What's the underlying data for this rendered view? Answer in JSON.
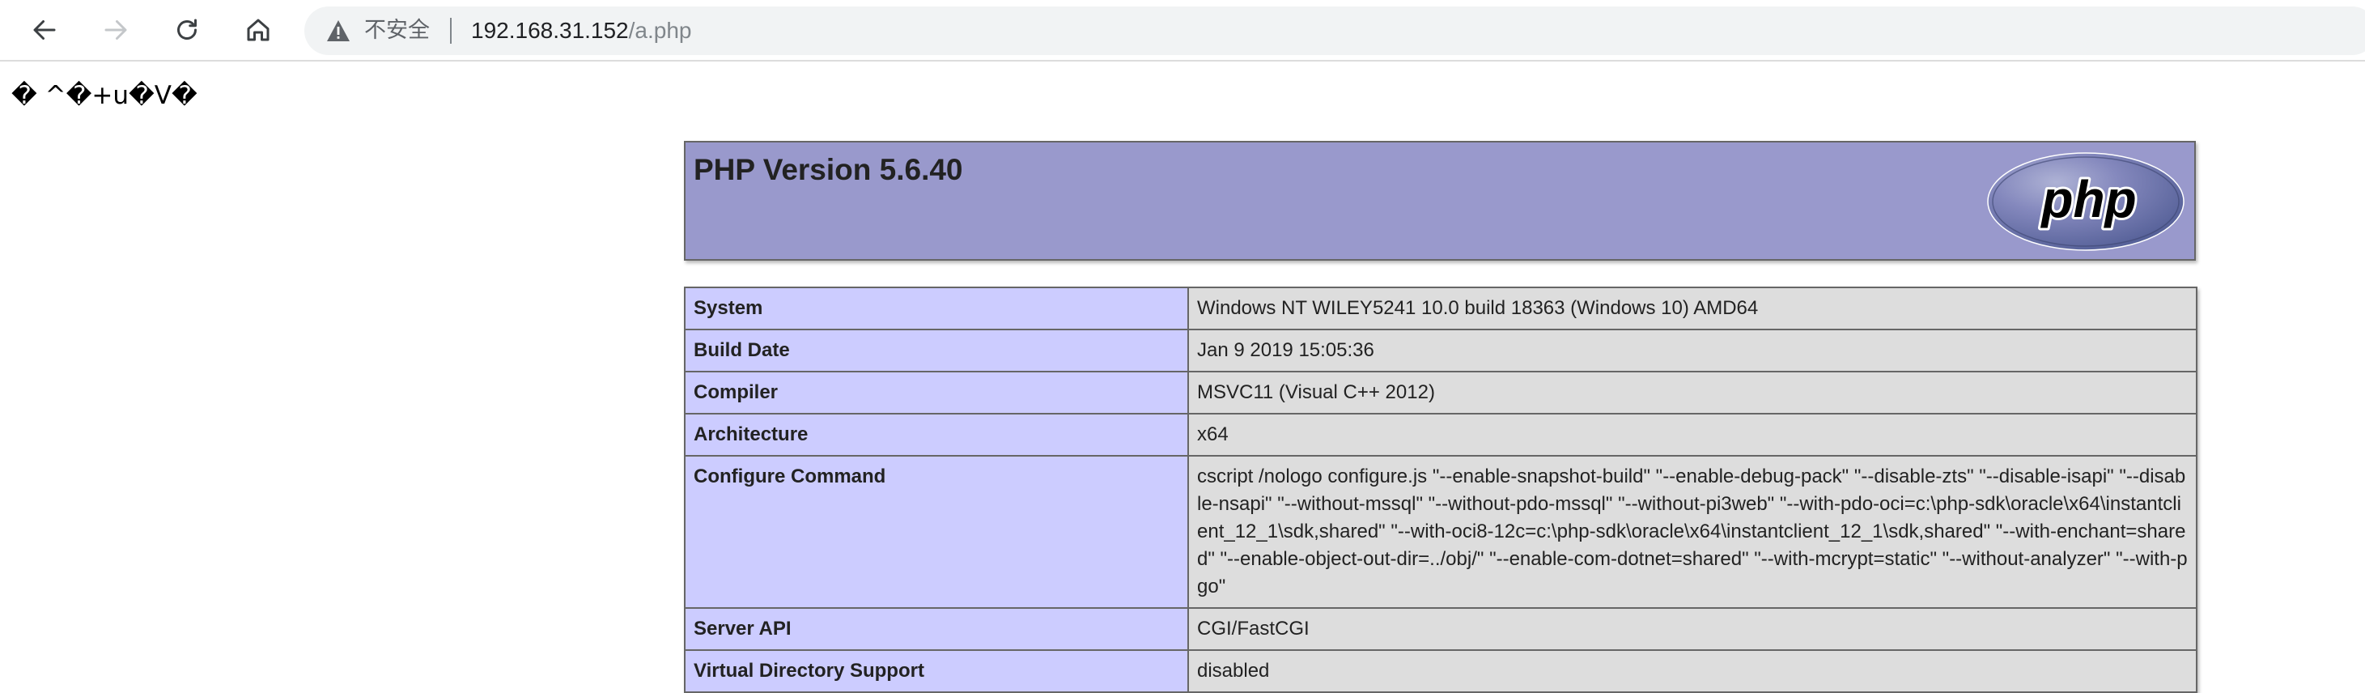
{
  "browser": {
    "security_label": "不安全",
    "url_host": "192.168.31.152",
    "url_path": "/a.php",
    "icons": {
      "back": "arrow-left-icon",
      "forward": "arrow-right-icon",
      "reload": "reload-icon",
      "home": "home-icon",
      "warning": "warning-triangle-icon"
    }
  },
  "page": {
    "garbled_text": "� ^�+u�V�",
    "php_title": "PHP Version 5.6.40",
    "php_logo_text": "php",
    "colors": {
      "header_bg": "#9999cc",
      "key_bg": "#ccccff",
      "value_bg": "#dddddd"
    },
    "rows": [
      {
        "key": "System",
        "value": "Windows NT WILEY5241 10.0 build 18363 (Windows 10) AMD64"
      },
      {
        "key": "Build Date",
        "value": "Jan 9 2019 15:05:36"
      },
      {
        "key": "Compiler",
        "value": "MSVC11 (Visual C++ 2012)"
      },
      {
        "key": "Architecture",
        "value": "x64"
      },
      {
        "key": "Configure Command",
        "value": "cscript /nologo configure.js \"--enable-snapshot-build\" \"--enable-debug-pack\" \"--disable-zts\" \"--disable-isapi\" \"--disable-nsapi\" \"--without-mssql\" \"--without-pdo-mssql\" \"--without-pi3web\" \"--with-pdo-oci=c:\\php-sdk\\oracle\\x64\\instantclient_12_1\\sdk,shared\" \"--with-oci8-12c=c:\\php-sdk\\oracle\\x64\\instantclient_12_1\\sdk,shared\" \"--with-enchant=shared\" \"--enable-object-out-dir=../obj/\" \"--enable-com-dotnet=shared\" \"--with-mcrypt=static\" \"--without-analyzer\" \"--with-pgo\""
      },
      {
        "key": "Server API",
        "value": "CGI/FastCGI"
      },
      {
        "key": "Virtual Directory Support",
        "value": "disabled"
      }
    ]
  }
}
